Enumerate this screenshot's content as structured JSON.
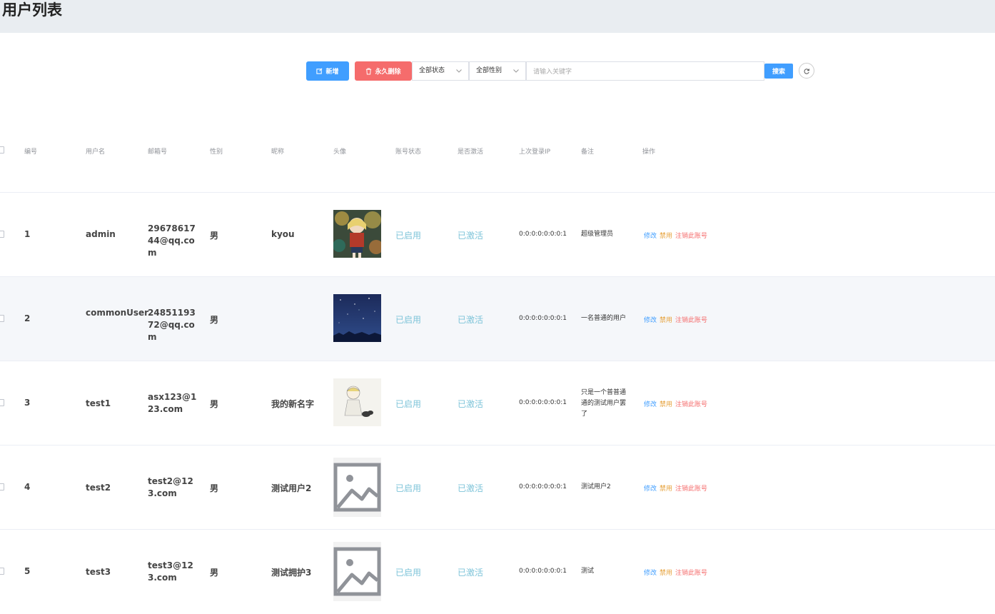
{
  "page": {
    "title": "用户列表"
  },
  "toolbar": {
    "add_label": "新增",
    "delete_label": "永久删除",
    "status_select": "全部状态",
    "gender_select": "全部性别",
    "search_placeholder": "请输入关键字",
    "search_label": "搜索"
  },
  "colors": {
    "primary": "#409eff",
    "danger": "#f56c6c",
    "warning": "#e6a23c",
    "status_text": "#7ec4d9",
    "header_bg": "#e9edf1"
  },
  "table": {
    "columns": [
      "编号",
      "用户名",
      "邮箱号",
      "性别",
      "昵称",
      "头像",
      "账号状态",
      "是否激活",
      "上次登录IP",
      "备注",
      "操作"
    ],
    "rows": [
      {
        "id": "1",
        "username": "admin",
        "email": "2967861744@qq.com",
        "sex": "男",
        "nickname": "kyou",
        "avatar": "anime-girl-forest",
        "state": "已启用",
        "active": "已激活",
        "ip": "0:0:0:0:0:0:0:1",
        "note": "超级管理员"
      },
      {
        "id": "2",
        "username": "commonUser",
        "email": "2485119372@qq.com",
        "sex": "男",
        "nickname": "",
        "avatar": "starry-night-sky",
        "state": "已启用",
        "active": "已激活",
        "ip": "0:0:0:0:0:0:0:1",
        "note": "一名普通的用户"
      },
      {
        "id": "3",
        "username": "test1",
        "email": "asx123@123.com",
        "sex": "男",
        "nickname": "我的新名字",
        "avatar": "sketch-girl",
        "state": "已启用",
        "active": "已激活",
        "ip": "0:0:0:0:0:0:0:1",
        "note": "只是一个普普通通的测试用户罢了"
      },
      {
        "id": "4",
        "username": "test2",
        "email": "test2@123.com",
        "sex": "男",
        "nickname": "测试用户2",
        "avatar": "image-placeholder-icon",
        "state": "已启用",
        "active": "已激活",
        "ip": "0:0:0:0:0:0:0:1",
        "note": "测试用户2"
      },
      {
        "id": "5",
        "username": "test3",
        "email": "test3@123.com",
        "sex": "男",
        "nickname": "测试拥护3",
        "avatar": "image-placeholder-icon",
        "state": "已启用",
        "active": "已激活",
        "ip": "0:0:0:0:0:0:0:1",
        "note": "测试"
      }
    ],
    "ops": {
      "edit": "修改",
      "ban": "禁用",
      "cancel": "注销此账号"
    }
  }
}
